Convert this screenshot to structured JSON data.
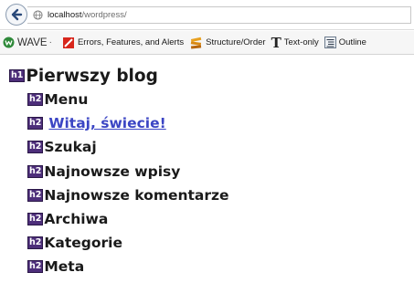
{
  "browser": {
    "url_host": "localhost",
    "url_path": "/wordpress/"
  },
  "toolbar": {
    "wave_label": "WAVE",
    "wave_separator": "·",
    "items": [
      {
        "label": "Errors, Features, and Alerts",
        "icon": "errors-icon"
      },
      {
        "label": "Structure/Order",
        "icon": "structure-icon"
      },
      {
        "label": "Text-only",
        "icon": "text-only-icon"
      },
      {
        "label": "Outline",
        "icon": "outline-icon"
      }
    ],
    "text_only_glyph": "T"
  },
  "outline": {
    "h1": {
      "badge": "h1",
      "text": "Pierwszy blog"
    },
    "h2": [
      {
        "badge": "h2",
        "text": "Menu",
        "link": false
      },
      {
        "badge": "h2",
        "text": "Witaj, świecie!",
        "link": true
      },
      {
        "badge": "h2",
        "text": "Szukaj",
        "link": false
      },
      {
        "badge": "h2",
        "text": "Najnowsze wpisy",
        "link": false
      },
      {
        "badge": "h2",
        "text": "Najnowsze komentarze",
        "link": false
      },
      {
        "badge": "h2",
        "text": "Archiwa",
        "link": false
      },
      {
        "badge": "h2",
        "text": "Kategorie",
        "link": false
      },
      {
        "badge": "h2",
        "text": "Meta",
        "link": false
      }
    ]
  },
  "colors": {
    "badge_bg": "#4d2e7a",
    "link": "#3b45c4"
  }
}
